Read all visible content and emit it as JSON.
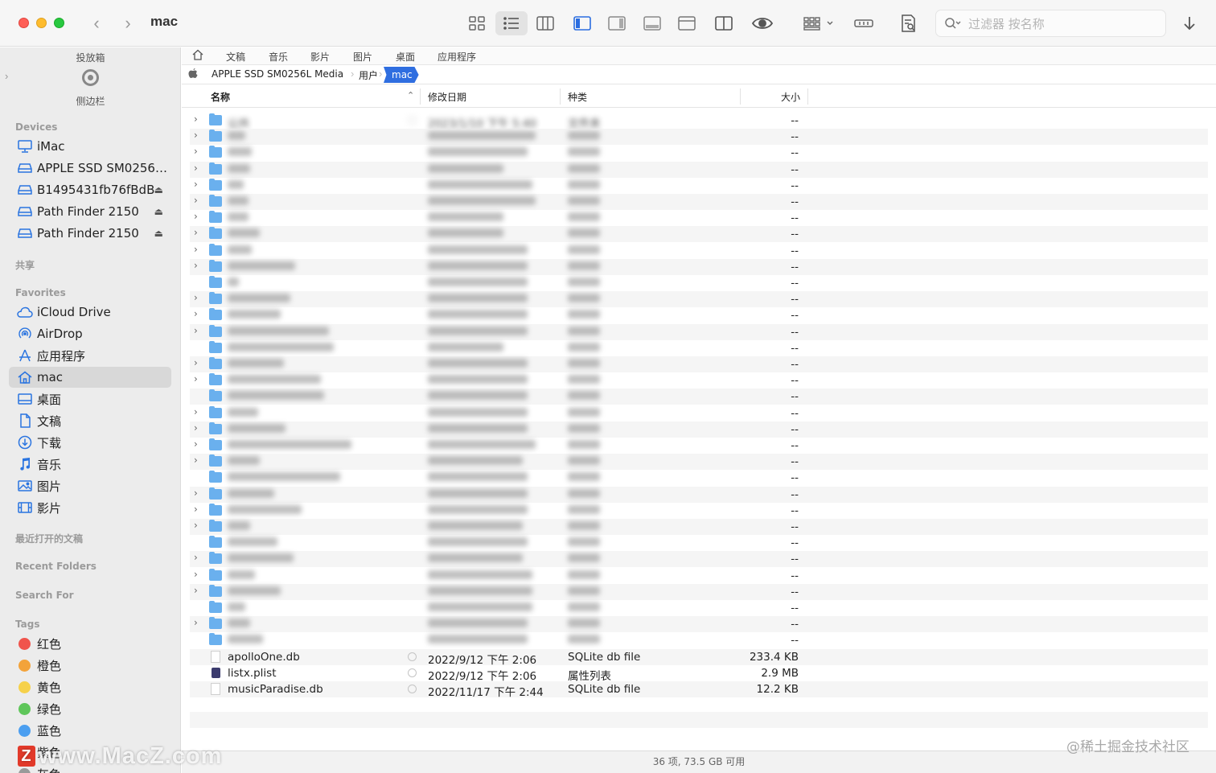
{
  "window": {
    "title": "mac"
  },
  "search": {
    "placeholder": "过滤器 按名称"
  },
  "sidebar": {
    "dropbox_label": "投放箱",
    "sidebar_label": "侧边栏",
    "sections": {
      "devices": "Devices",
      "shared": "共享",
      "favorites": "Favorites",
      "recent_docs": "最近打开的文稿",
      "recent_folders": "Recent Folders",
      "search_for": "Search For",
      "tags": "Tags"
    },
    "devices": [
      {
        "label": "iMac",
        "icon": "imac-icon",
        "eject": false
      },
      {
        "label": "APPLE SSD SM0256L...",
        "icon": "drive-icon",
        "eject": false
      },
      {
        "label": "B1495431fb76fBdB",
        "icon": "drive-icon",
        "eject": true
      },
      {
        "label": "Path Finder 2150",
        "icon": "drive-icon",
        "eject": true
      },
      {
        "label": "Path Finder 2150",
        "icon": "drive-icon",
        "eject": true
      }
    ],
    "favorites": [
      {
        "label": "iCloud Drive",
        "icon": "cloud-icon"
      },
      {
        "label": "AirDrop",
        "icon": "airdrop-icon"
      },
      {
        "label": "应用程序",
        "icon": "applications-icon"
      },
      {
        "label": "mac",
        "icon": "home-icon",
        "active": true
      },
      {
        "label": "桌面",
        "icon": "desktop-icon"
      },
      {
        "label": "文稿",
        "icon": "document-icon"
      },
      {
        "label": "下载",
        "icon": "download-icon"
      },
      {
        "label": "音乐",
        "icon": "music-icon"
      },
      {
        "label": "图片",
        "icon": "picture-icon"
      },
      {
        "label": "影片",
        "icon": "movie-icon"
      }
    ],
    "tags": [
      {
        "label": "红色",
        "color": "#f0544c"
      },
      {
        "label": "橙色",
        "color": "#f3a33a"
      },
      {
        "label": "黄色",
        "color": "#f6d14a"
      },
      {
        "label": "绿色",
        "color": "#5fc65a"
      },
      {
        "label": "蓝色",
        "color": "#4c9ff0"
      },
      {
        "label": "紫色",
        "color": "#b06ad6"
      },
      {
        "label": "灰色",
        "color": "#9a9a9a"
      }
    ]
  },
  "favbar": [
    "文稿",
    "音乐",
    "影片",
    "图片",
    "桌面",
    "应用程序"
  ],
  "pathbar": {
    "root": "APPLE SSD SM0256L Media",
    "mid": "用户",
    "current": "mac"
  },
  "columns": {
    "name": "名称",
    "date": "修改日期",
    "kind": "种类",
    "size": "大小"
  },
  "blurred_folder_count": 33,
  "folder_size": "--",
  "first_folder": {
    "name": "公共",
    "date": "2023/1/10 下午 5:40",
    "kind": "文件夹"
  },
  "files": [
    {
      "name": "apolloOne.db",
      "date": "2022/9/12 下午 2:06",
      "kind": "SQLite db file",
      "size": "233.4 KB",
      "icon": "file-icon"
    },
    {
      "name": "listx.plist",
      "date": "2022/9/12 下午 2:06",
      "kind": "属性列表",
      "size": "2.9 MB",
      "icon": "plist-icon"
    },
    {
      "name": "musicParadise.db",
      "date": "2022/11/17 下午 2:44",
      "kind": "SQLite db file",
      "size": "12.2 KB",
      "icon": "file-icon"
    }
  ],
  "status": "36 项, 73.5 GB 可用",
  "watermarks": {
    "left": "www.MacZ.com",
    "right": "@稀土掘金技术社区"
  }
}
